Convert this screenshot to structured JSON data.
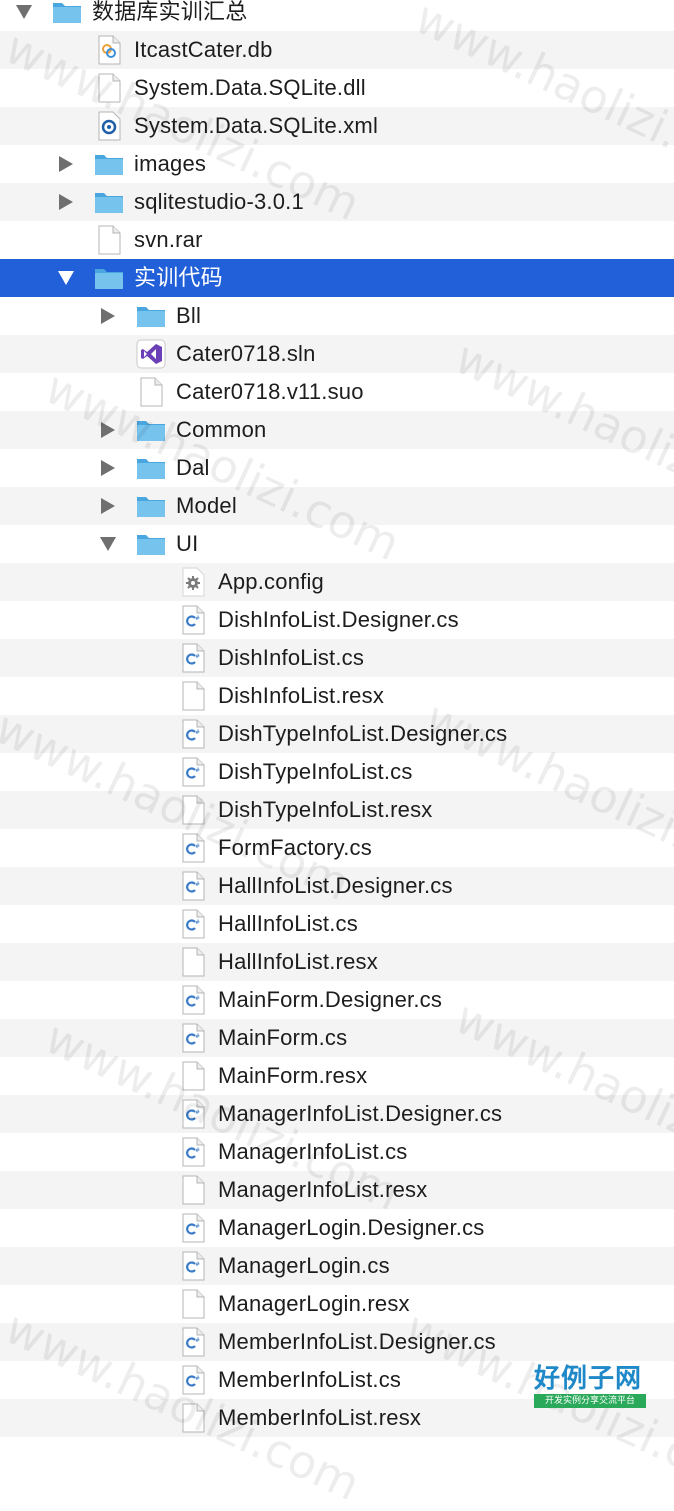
{
  "tree": {
    "rows": [
      {
        "label": "数据库实训汇总",
        "depth": 0,
        "type": "folder",
        "icon": "folder-icon",
        "expanded": true
      },
      {
        "label": "ItcastCater.db",
        "depth": 1,
        "type": "file",
        "icon": "db-file-icon"
      },
      {
        "label": "System.Data.SQLite.dll",
        "depth": 1,
        "type": "file",
        "icon": "document-icon"
      },
      {
        "label": "System.Data.SQLite.xml",
        "depth": 1,
        "type": "file",
        "icon": "xml-file-icon"
      },
      {
        "label": "images",
        "depth": 1,
        "type": "folder",
        "icon": "folder-icon",
        "expanded": false
      },
      {
        "label": "sqlitestudio-3.0.1",
        "depth": 1,
        "type": "folder",
        "icon": "folder-icon",
        "expanded": false
      },
      {
        "label": "svn.rar",
        "depth": 1,
        "type": "file",
        "icon": "document-icon"
      },
      {
        "label": "实训代码",
        "depth": 1,
        "type": "folder",
        "icon": "folder-icon",
        "expanded": true,
        "selected": true
      },
      {
        "label": "Bll",
        "depth": 2,
        "type": "folder",
        "icon": "folder-icon",
        "expanded": false
      },
      {
        "label": "Cater0718.sln",
        "depth": 2,
        "type": "file",
        "icon": "visual-studio-icon"
      },
      {
        "label": "Cater0718.v11.suo",
        "depth": 2,
        "type": "file",
        "icon": "document-icon"
      },
      {
        "label": "Common",
        "depth": 2,
        "type": "folder",
        "icon": "folder-icon",
        "expanded": false
      },
      {
        "label": "Dal",
        "depth": 2,
        "type": "folder",
        "icon": "folder-icon",
        "expanded": false
      },
      {
        "label": "Model",
        "depth": 2,
        "type": "folder",
        "icon": "folder-icon",
        "expanded": false
      },
      {
        "label": "UI",
        "depth": 2,
        "type": "folder",
        "icon": "folder-icon",
        "expanded": true
      },
      {
        "label": "App.config",
        "depth": 3,
        "type": "file",
        "icon": "config-gear-icon"
      },
      {
        "label": "DishInfoList.Designer.cs",
        "depth": 3,
        "type": "file",
        "icon": "csharp-file-icon"
      },
      {
        "label": "DishInfoList.cs",
        "depth": 3,
        "type": "file",
        "icon": "csharp-file-icon"
      },
      {
        "label": "DishInfoList.resx",
        "depth": 3,
        "type": "file",
        "icon": "document-icon"
      },
      {
        "label": "DishTypeInfoList.Designer.cs",
        "depth": 3,
        "type": "file",
        "icon": "csharp-file-icon"
      },
      {
        "label": "DishTypeInfoList.cs",
        "depth": 3,
        "type": "file",
        "icon": "csharp-file-icon"
      },
      {
        "label": "DishTypeInfoList.resx",
        "depth": 3,
        "type": "file",
        "icon": "document-icon"
      },
      {
        "label": "FormFactory.cs",
        "depth": 3,
        "type": "file",
        "icon": "csharp-file-icon"
      },
      {
        "label": "HallInfoList.Designer.cs",
        "depth": 3,
        "type": "file",
        "icon": "csharp-file-icon"
      },
      {
        "label": "HallInfoList.cs",
        "depth": 3,
        "type": "file",
        "icon": "csharp-file-icon"
      },
      {
        "label": "HallInfoList.resx",
        "depth": 3,
        "type": "file",
        "icon": "document-icon"
      },
      {
        "label": "MainForm.Designer.cs",
        "depth": 3,
        "type": "file",
        "icon": "csharp-file-icon"
      },
      {
        "label": "MainForm.cs",
        "depth": 3,
        "type": "file",
        "icon": "csharp-file-icon"
      },
      {
        "label": "MainForm.resx",
        "depth": 3,
        "type": "file",
        "icon": "document-icon"
      },
      {
        "label": "ManagerInfoList.Designer.cs",
        "depth": 3,
        "type": "file",
        "icon": "csharp-file-icon"
      },
      {
        "label": "ManagerInfoList.cs",
        "depth": 3,
        "type": "file",
        "icon": "csharp-file-icon"
      },
      {
        "label": "ManagerInfoList.resx",
        "depth": 3,
        "type": "file",
        "icon": "document-icon"
      },
      {
        "label": "ManagerLogin.Designer.cs",
        "depth": 3,
        "type": "file",
        "icon": "csharp-file-icon"
      },
      {
        "label": "ManagerLogin.cs",
        "depth": 3,
        "type": "file",
        "icon": "csharp-file-icon"
      },
      {
        "label": "ManagerLogin.resx",
        "depth": 3,
        "type": "file",
        "icon": "document-icon"
      },
      {
        "label": "MemberInfoList.Designer.cs",
        "depth": 3,
        "type": "file",
        "icon": "csharp-file-icon"
      },
      {
        "label": "MemberInfoList.cs",
        "depth": 3,
        "type": "file",
        "icon": "csharp-file-icon"
      },
      {
        "label": "MemberInfoList.resx",
        "depth": 3,
        "type": "file",
        "icon": "document-icon"
      }
    ]
  },
  "watermark": {
    "text": "www.haolizi.com"
  },
  "logo": {
    "main": "好例子网",
    "sub": "开发实例分享交流平台"
  },
  "colors": {
    "selection": "#2160d8",
    "folder": "#5fb6e8",
    "stripe": "#f4f4f4"
  }
}
